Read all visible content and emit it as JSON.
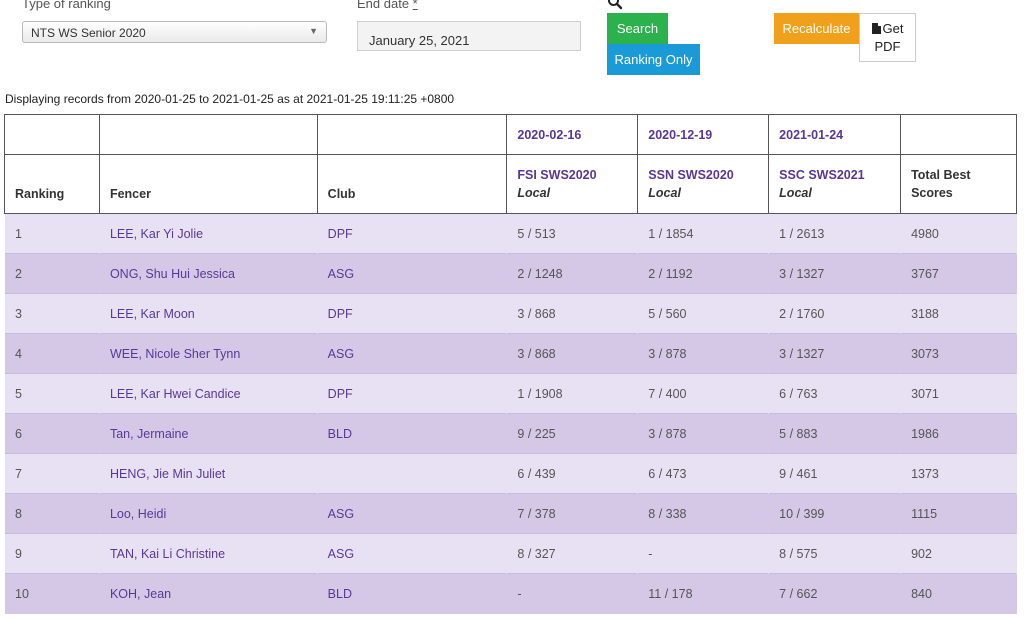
{
  "filters": {
    "type_label": "Type of ranking",
    "type_value": "NTS WS Senior 2020",
    "end_date_label": "End date",
    "end_date_required": "*",
    "end_date_value": "January 25, 2021"
  },
  "buttons": {
    "search": "Search",
    "ranking_only": "Ranking Only",
    "recalculate": "Recalculate",
    "get_pdf_line1": "Get",
    "get_pdf_line2": "PDF"
  },
  "icons": {
    "search": "search-icon",
    "select_arrow": "chevron-down-icon",
    "pdf": "pdf-file-icon"
  },
  "colors": {
    "search": "#2bb24c",
    "ranking_only": "#1a9ad6",
    "recalculate": "#f0a01a",
    "link": "#5a3796",
    "row_light": "#e8e1f3",
    "row_dark": "#d4c8e6"
  },
  "records_info": "Displaying records from 2020-01-25 to 2021-01-25 as at 2021-01-25 19:11:25 +0800",
  "table": {
    "headers": {
      "ranking": "Ranking",
      "fencer": "Fencer",
      "club": "Club",
      "total": "Total Best Scores"
    },
    "events": [
      {
        "date": "2020-02-16",
        "name": "FSI SWS2020",
        "scope": "Local"
      },
      {
        "date": "2020-12-19",
        "name": "SSN SWS2020",
        "scope": "Local"
      },
      {
        "date": "2021-01-24",
        "name": "SSC SWS2021",
        "scope": "Local"
      }
    ],
    "rows": [
      {
        "rank": "1",
        "fencer": "LEE, Kar Yi Jolie",
        "club": "DPF",
        "e1": "5 / 513",
        "e2": "1 / 1854",
        "e3": "1 / 2613",
        "total": "4980"
      },
      {
        "rank": "2",
        "fencer": "ONG, Shu Hui Jessica",
        "club": "ASG",
        "e1": "2 / 1248",
        "e2": "2 / 1192",
        "e3": "3 / 1327",
        "total": "3767"
      },
      {
        "rank": "3",
        "fencer": "LEE, Kar Moon",
        "club": "DPF",
        "e1": "3 / 868",
        "e2": "5 / 560",
        "e3": "2 / 1760",
        "total": "3188"
      },
      {
        "rank": "4",
        "fencer": "WEE, Nicole Sher Tynn",
        "club": "ASG",
        "e1": "3 / 868",
        "e2": "3 / 878",
        "e3": "3 / 1327",
        "total": "3073"
      },
      {
        "rank": "5",
        "fencer": "LEE, Kar Hwei Candice",
        "club": "DPF",
        "e1": "1 / 1908",
        "e2": "7 / 400",
        "e3": "6 / 763",
        "total": "3071"
      },
      {
        "rank": "6",
        "fencer": "Tan, Jermaine",
        "club": "BLD",
        "e1": "9 / 225",
        "e2": "3 / 878",
        "e3": "5 / 883",
        "total": "1986"
      },
      {
        "rank": "7",
        "fencer": "HENG, Jie Min Juliet",
        "club": "",
        "e1": "6 / 439",
        "e2": "6 / 473",
        "e3": "9 / 461",
        "total": "1373"
      },
      {
        "rank": "8",
        "fencer": "Loo, Heidi",
        "club": "ASG",
        "e1": "7 / 378",
        "e2": "8 / 338",
        "e3": "10 / 399",
        "total": "1115"
      },
      {
        "rank": "9",
        "fencer": "TAN, Kai Li Christine",
        "club": "ASG",
        "e1": "8 / 327",
        "e2": "-",
        "e3": "8 / 575",
        "total": "902"
      },
      {
        "rank": "10",
        "fencer": "KOH, Jean",
        "club": "BLD",
        "e1": "-",
        "e2": "11 / 178",
        "e3": "7 / 662",
        "total": "840"
      }
    ]
  }
}
